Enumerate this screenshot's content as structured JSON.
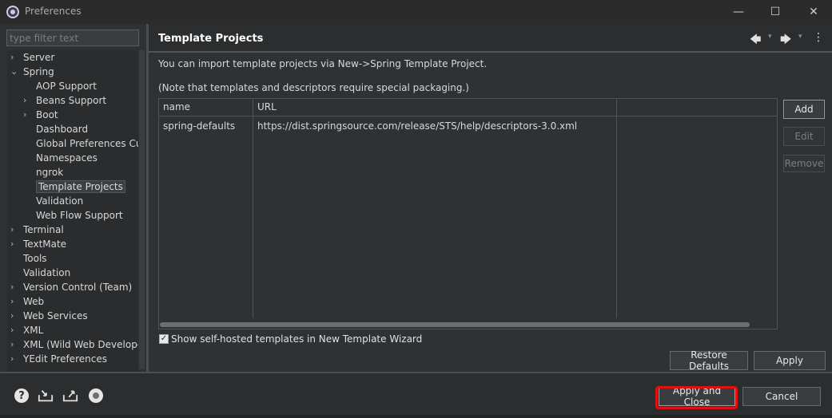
{
  "window": {
    "title": "Preferences",
    "minimize": "—",
    "maximize": "☐",
    "close": "✕"
  },
  "filter": {
    "placeholder": "type filter text",
    "value": ""
  },
  "tree": {
    "items": [
      {
        "label": "Server",
        "level": 0,
        "arrow": "›"
      },
      {
        "label": "Spring",
        "level": 0,
        "arrow": "⌄"
      },
      {
        "label": "AOP Support",
        "level": 1,
        "arrow": ""
      },
      {
        "label": "Beans Support",
        "level": 1,
        "arrow": "›"
      },
      {
        "label": "Boot",
        "level": 1,
        "arrow": "›"
      },
      {
        "label": "Dashboard",
        "level": 1,
        "arrow": ""
      },
      {
        "label": "Global Preferences Cur",
        "level": 1,
        "arrow": ""
      },
      {
        "label": "Namespaces",
        "level": 1,
        "arrow": ""
      },
      {
        "label": "ngrok",
        "level": 1,
        "arrow": ""
      },
      {
        "label": "Template Projects",
        "level": 1,
        "arrow": "",
        "selected": true
      },
      {
        "label": "Validation",
        "level": 1,
        "arrow": ""
      },
      {
        "label": "Web Flow Support",
        "level": 1,
        "arrow": ""
      },
      {
        "label": "Terminal",
        "level": 0,
        "arrow": "›"
      },
      {
        "label": "TextMate",
        "level": 0,
        "arrow": "›"
      },
      {
        "label": "Tools",
        "level": 0,
        "arrow": ""
      },
      {
        "label": "Validation",
        "level": 0,
        "arrow": ""
      },
      {
        "label": "Version Control (Team)",
        "level": 0,
        "arrow": "›"
      },
      {
        "label": "Web",
        "level": 0,
        "arrow": "›"
      },
      {
        "label": "Web Services",
        "level": 0,
        "arrow": "›"
      },
      {
        "label": "XML",
        "level": 0,
        "arrow": "›"
      },
      {
        "label": "XML (Wild Web Develope",
        "level": 0,
        "arrow": "›"
      },
      {
        "label": "YEdit Preferences",
        "level": 0,
        "arrow": "›"
      }
    ]
  },
  "page": {
    "title": "Template Projects",
    "back": "🡄",
    "forward": "🡆",
    "menu": "⋮",
    "dropdown": "▾",
    "description1": "You can import template projects via New->Spring Template Project.",
    "description2": "(Note that templates and descriptors require special packaging.)",
    "table": {
      "columns": [
        "name",
        "URL",
        ""
      ],
      "rows": [
        [
          "spring-defaults",
          "https://dist.springsource.com/release/STS/help/descriptors-3.0.xml",
          ""
        ]
      ]
    },
    "buttons": {
      "add": "Add",
      "edit": "Edit",
      "remove": "Remove"
    },
    "checkbox": {
      "label": "Show self-hosted templates in New Template Wizard",
      "checked": true,
      "mark": "✓"
    },
    "restore_defaults": "Restore Defaults",
    "apply": "Apply"
  },
  "footer": {
    "help_icon": "?",
    "apply_and_close": "Apply and Close",
    "cancel": "Cancel"
  },
  "colors": {
    "highlight": "#e01010",
    "background": "#2f3234"
  }
}
